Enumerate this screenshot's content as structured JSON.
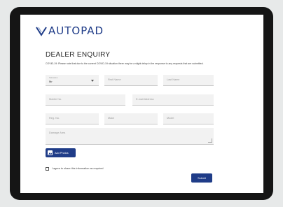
{
  "brand": {
    "logo_text": "AUTOPAD",
    "color": "#1f3c88"
  },
  "form": {
    "title": "DEALER ENQUIRY",
    "notice": "COVID-19: Please note that due to the current COVID-19 situation there may be a slight delay in the response to any requests that are submitted.",
    "salutation": {
      "label": "Salutation",
      "value": "Mr"
    },
    "first_name": {
      "placeholder": "First Name"
    },
    "last_name": {
      "placeholder": "Last Name"
    },
    "mobile": {
      "placeholder": "Mobile No."
    },
    "email": {
      "placeholder": "E-mail Address"
    },
    "reg_no": {
      "placeholder": "Reg. No."
    },
    "make": {
      "placeholder": "Make"
    },
    "model": {
      "placeholder": "Model"
    },
    "damage": {
      "placeholder": "Damage Area"
    },
    "add_photos_label": "Add Photos",
    "consent_label": "I agree to share this information as required",
    "submit_label": "Submit"
  }
}
